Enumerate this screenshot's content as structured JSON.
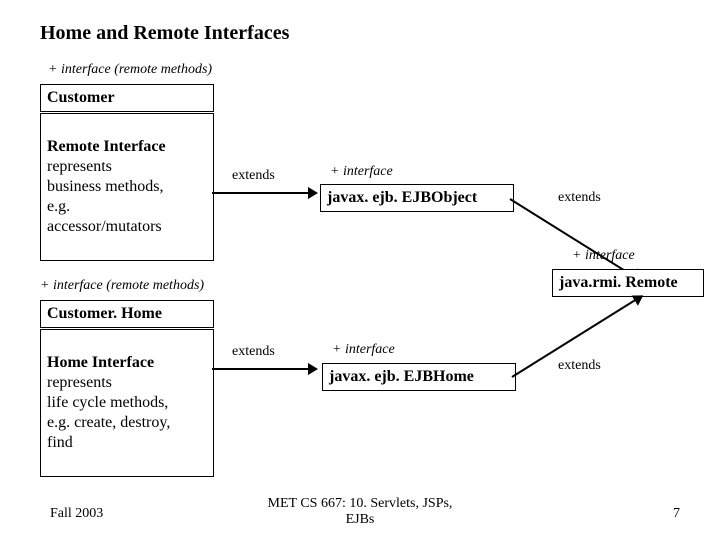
{
  "title": "Home and Remote Interfaces",
  "stereotypes": {
    "remote1": "+ interface (remote methods)",
    "remote2": "+ interface (remote methods)",
    "iface1": "+ interface",
    "iface2": "+ interface",
    "iface3": "+ interface"
  },
  "boxes": {
    "customer": "Customer",
    "remote_iface_line1": "Remote Interface",
    "remote_iface_rest": "represents\nbusiness methods,\ne.g.\naccessor/mutators",
    "customer_home": "Customer. Home",
    "home_iface_line1": "Home Interface",
    "home_iface_rest": "represents\nlife cycle methods,\ne.g. create, destroy,\nfind",
    "ejb_object": "javax. ejb. EJBObject",
    "ejb_home": "javax. ejb. EJBHome",
    "rmi_remote": "java.rmi. Remote"
  },
  "labels": {
    "extends1": "extends",
    "extends2": "extends",
    "extends3": "extends",
    "extends4": "extends"
  },
  "footer": {
    "left": "Fall 2003",
    "center": "MET CS 667: 10. Servlets, JSPs,\nEJBs",
    "right": "7"
  }
}
